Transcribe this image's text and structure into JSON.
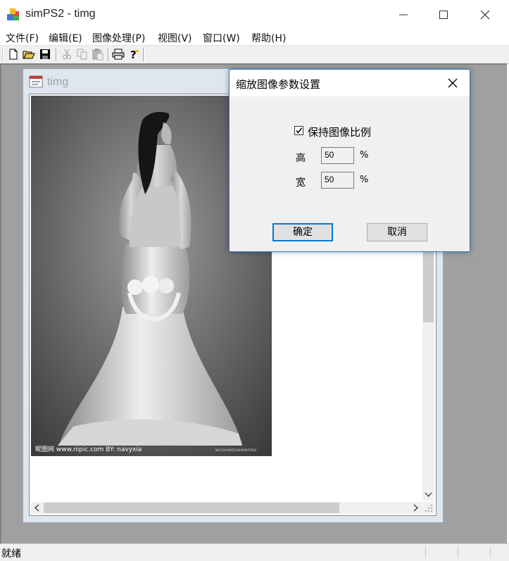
{
  "window": {
    "title": "simPS2 - timg"
  },
  "menu": [
    "文件(F)",
    "编辑(E)",
    "图像处理(P)",
    "视图(V)",
    "窗口(W)",
    "帮助(H)"
  ],
  "toolbar": [
    "new-icon",
    "open-icon",
    "save-icon",
    "cut-icon",
    "copy-icon",
    "paste-icon",
    "print-icon",
    "help-icon"
  ],
  "child": {
    "title": "timg",
    "image_watermark": "昵图网 www.nipic.com   BY: navyxia",
    "image_id": "NO:20100802184409970922"
  },
  "dialog": {
    "title": "缩放图像参数设置",
    "keep_ratio_label": "保持图像比例",
    "keep_ratio_checked": true,
    "height_label": "高",
    "height_value": "50",
    "width_label": "宽",
    "width_value": "50",
    "unit": "%",
    "ok_label": "确定",
    "cancel_label": "取消"
  },
  "status": {
    "text": "就绪"
  },
  "colors": {
    "accent": "#0078d7",
    "dialog_border": "#2b79d6",
    "mdi_bg": "#a0a0a0"
  }
}
